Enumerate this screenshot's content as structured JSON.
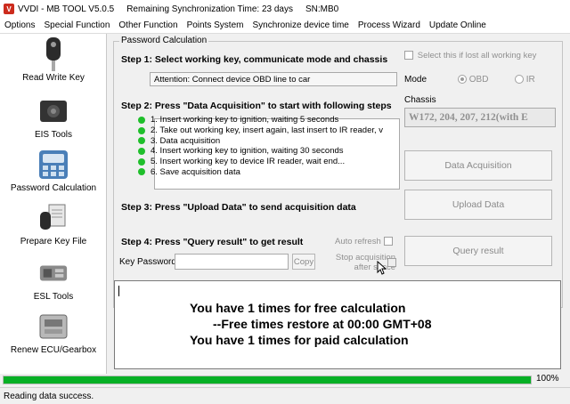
{
  "titlebar": {
    "app_title": "VVDI - MB TOOL V5.0.5",
    "sync_time": "Remaining Synchronization Time: 23 days",
    "serial": "SN:MB0"
  },
  "menu": [
    "Options",
    "Special Function",
    "Other Function",
    "Points System",
    "Synchronize device time",
    "Process Wizard",
    "Update Online"
  ],
  "sidebar": {
    "items": [
      {
        "label": "Read Write Key",
        "icon": "car-key-icon"
      },
      {
        "label": "EIS Tools",
        "icon": "eis-module-icon"
      },
      {
        "label": "Password Calculation",
        "icon": "password-calculation-icon"
      },
      {
        "label": "Prepare Key File",
        "icon": "key-file-icon"
      },
      {
        "label": "ESL Tools",
        "icon": "esl-module-icon"
      },
      {
        "label": "Renew ECU/Gearbox",
        "icon": "ecu-module-icon"
      }
    ]
  },
  "panel": {
    "legend": "Password Calculation",
    "step1": "Step 1: Select working key, communicate mode and chassis",
    "attention": "Attention: Connect device OBD line to car",
    "lost_all_keys": "Select this if lost all working key",
    "mode_label": "Mode",
    "mode_obd": "OBD",
    "mode_ir": "IR",
    "chassis_label": "Chassis",
    "chassis_value": "W172, 204, 207, 212(with E",
    "step2": "Step 2: Press \"Data Acquisition\" to start with following steps",
    "instructions": [
      "1. Insert working key to ignition, waiting 5 seconds",
      "2. Take out working key, insert again, last insert to IR reader, v",
      "3. Data acquisition",
      "4. Insert working key to ignition, waiting 30 seconds",
      "5. Insert working key to device IR reader, wait end...",
      "6. Save acquisition data"
    ],
    "data_acquisition_button": "Data Acquisition",
    "step3": "Step 3: Press \"Upload Data\" to send acquisition data",
    "upload_button": "Upload Data",
    "step4": "Step 4: Press \"Query result\" to get result",
    "auto_refresh": "Auto refresh",
    "stop_acquisition": "Stop acquisition",
    "after_success": "after succe",
    "key_password_label": "Key Password",
    "key_password_value": "",
    "copy_button": "Copy",
    "query_button": "Query result"
  },
  "output": {
    "line1": "You have 1 times for free calculation",
    "line2": "--Free times restore at 00:00 GMT+08",
    "line3": "You have 1 times for paid calculation"
  },
  "progress": {
    "value": 100,
    "label": "100%"
  },
  "status": "Reading data success.",
  "colors": {
    "progress_green": "#06b025",
    "step_dot_green": "#1fbf2b",
    "app_icon_red": "#cc2b1d"
  }
}
